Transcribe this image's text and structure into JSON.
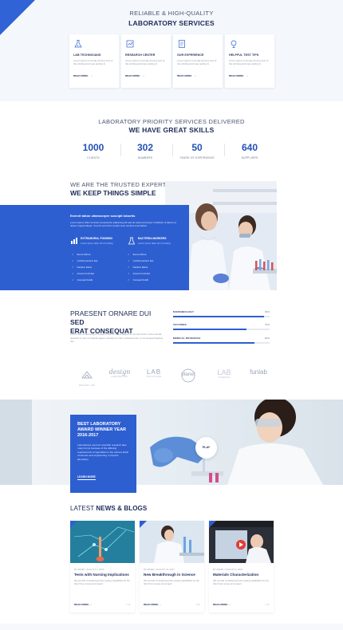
{
  "services": {
    "title_small": "RELIABLE & HIGH-QUALITY",
    "title_big": "LABORATORY SERVICES",
    "cards": [
      {
        "icon": "flask-icon",
        "name": "LAB TECHNICIANS",
        "text": "Lorem ipsum is simply dummy text of the printing and type setting in.",
        "more": "READ MORE"
      },
      {
        "icon": "research-icon",
        "name": "RESEARCH CENTER",
        "text": "Lorem ipsum is simply dummy text of the printing and type setting in.",
        "more": "READ MORE"
      },
      {
        "icon": "experience-icon",
        "name": "OUR EXPERIENCE",
        "text": "Lorem ipsum is simply dummy text of the printing and type setting in.",
        "more": "READ MORE"
      },
      {
        "icon": "test-tips-icon",
        "name": "HELPFUL TEST TIPS",
        "text": "Lorem ipsum is simply dummy text of the printing and type setting in.",
        "more": "READ MORE"
      }
    ]
  },
  "stats": {
    "title_small": "LABORATORY PRIORITY SERVICES DELIVERED",
    "title_big": "WE HAVE GREAT SKILLS",
    "items": [
      {
        "value": "1000",
        "label": "CLIENTS"
      },
      {
        "value": "302",
        "label": "NUMBERS"
      },
      {
        "value": "50",
        "label": "YEARS OF EXPERIENCE"
      },
      {
        "value": "640",
        "label": "SUPPLIERS"
      }
    ]
  },
  "trusted": {
    "title_small": "WE ARE THE TRUSTED EXPERTS",
    "title_big": "WE KEEP THINGS SIMPLE",
    "panel_head": "Exercit tation ullamcorper suscipit lobortis",
    "panel_text": "Lorem ipsum dolor sit amet consectetur adipiscing elit sed do eiusmod tempor incididunt ut labore et dolore magna aliqua. Ut enim ad minim veniam quis nostrud exercitation.",
    "features": [
      {
        "icon": "funding-icon",
        "title": "EXTRAMURAL FUNDING",
        "text": "Lorem ipsum dolor sit in Funding"
      },
      {
        "icon": "bacteria-icon",
        "title": "BACTERIA MARKERS",
        "text": "Lorem ipsum dolor sit in Funding"
      }
    ],
    "list_left": [
      "Evere Minus",
      "Confiromentem Est",
      "Decibor Elsus",
      "Accenti Incit Est",
      "Compelt Fuldit"
    ],
    "list_right": [
      "Evere Minus",
      "Confiromentem Est",
      "Decibor Elsus",
      "Accenti Incit Est",
      "Compelt Fuldit"
    ]
  },
  "progress": {
    "title_normal": "PRAESENT ORNARE DUI ",
    "title_bold_1": "SED",
    "title_bold_2": "ERAT CONSEQUAT",
    "text": "Lorem ipsum ullamcorper suscipit lobortis nisl ut aliquip ex ea commodo. Fusce iaculis pharetra in nisl, eu blandit augue molestie id. Nam vehicula enim, ut consequat dapibus nec.",
    "bars": [
      {
        "name": "MICROBIOLOGY",
        "percent": 94,
        "label": "94%"
      },
      {
        "name": "VACCINES",
        "percent": 76,
        "label": "76%"
      },
      {
        "name": "MEDICAL RESEARCH",
        "percent": 84,
        "label": "84%"
      }
    ]
  },
  "logos": [
    {
      "name": "DESIGN LAB",
      "sub": ""
    },
    {
      "name": "design",
      "sub": "LABORATORY"
    },
    {
      "name": "LAB",
      "sub": "SOLUTIONS"
    },
    {
      "name": "planet",
      "sub": ""
    },
    {
      "name": "LAB",
      "sub": "SCIENCE"
    },
    {
      "name": "funlab",
      "sub": ""
    }
  ],
  "award": {
    "title": "BEST LABORATORY AWARD WINNER YEAR 2016-2017",
    "text": "Laboratories used for scientific research take many forms because of the differing requirements of specialists in the various fields of science and engineering. A physics laboratory.",
    "button": "LEARN MORE",
    "play": "PLAY"
  },
  "news": {
    "title_normal": "LATEST ",
    "title_bold": "NEWS & BLOGS",
    "posts": [
      {
        "meta": "BY ADMIN / AUGUST 4, 2016",
        "title": "Tests with Nursing Implications",
        "text": "We provide consulted genuine paying capabilities for the client from scope and project.",
        "more": "READ MORE",
        "comments": "4"
      },
      {
        "meta": "BY ADMIN / AUGUST 12, 2017",
        "title": "New Breakthrough in Science",
        "text": "We provide consulted genuine paying capabilities for the client from scope and project.",
        "more": "READ MORE",
        "comments": "6"
      },
      {
        "meta": "BY ADMIN / AUGUST 9, 2016",
        "title": "Materials Characterization",
        "text": "We provide consulted genuine paying capabilities for the client from scope and project.",
        "more": "READ MORE",
        "comments": "4"
      }
    ]
  },
  "colors": {
    "accent": "#2e5fd1",
    "navy": "#1d2a57",
    "muted": "#8c93a6"
  }
}
